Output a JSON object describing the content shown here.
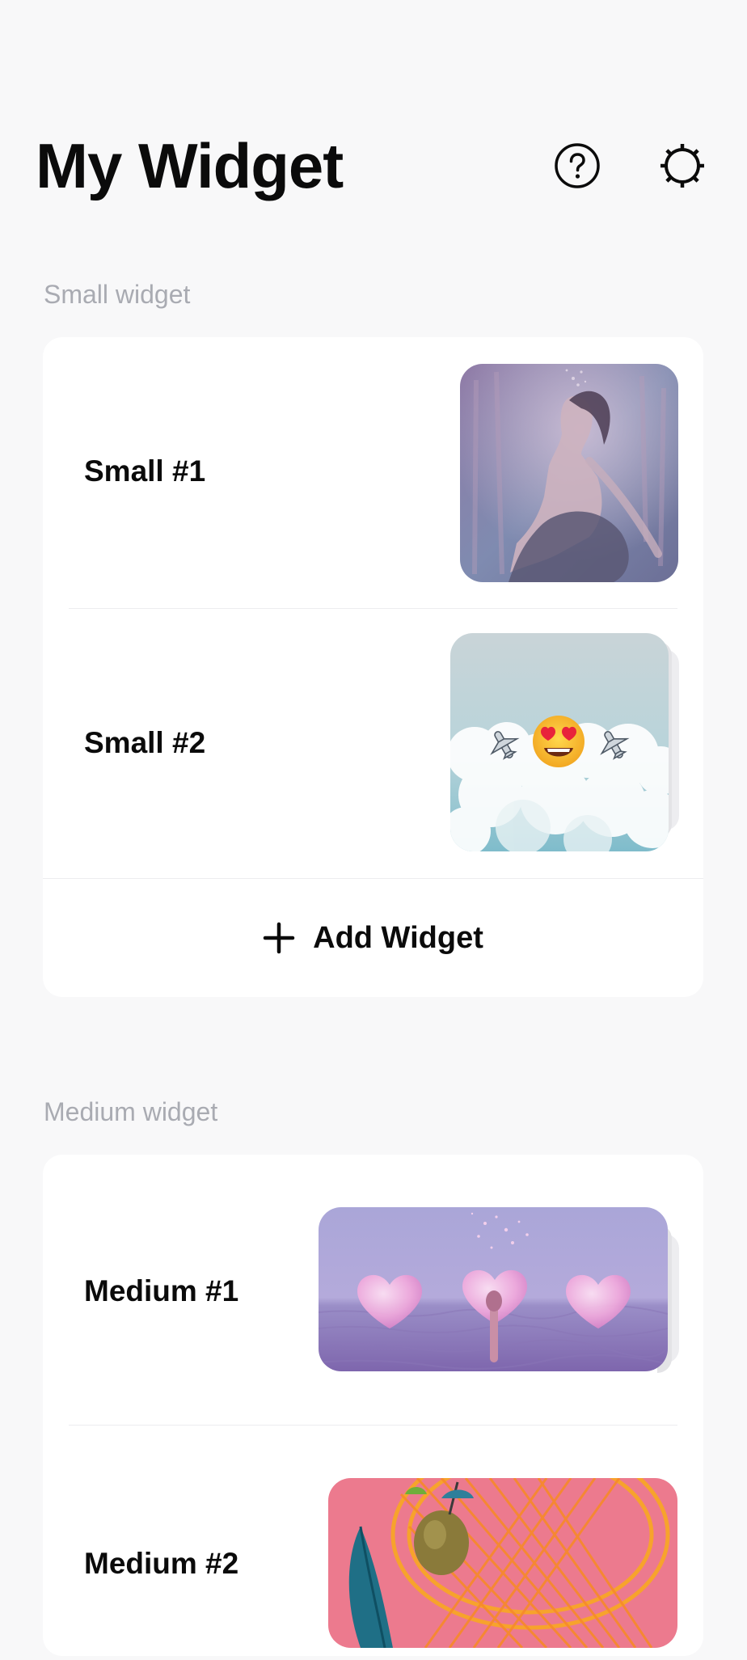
{
  "header": {
    "title": "My Widget",
    "help_icon": "help-circle-icon",
    "settings_icon": "gear-icon"
  },
  "small_section": {
    "label": "Small widget",
    "items": [
      {
        "label": "Small #1",
        "preview": "woman-underwater-photo"
      },
      {
        "label": "Small #2",
        "preview": "clouds-airplane-heart-eyes-emoji-photo"
      }
    ],
    "add_button": {
      "icon": "plus-icon",
      "label": "Add Widget"
    }
  },
  "medium_section": {
    "label": "Medium widget",
    "items": [
      {
        "label": "Medium #1",
        "preview": "pink-hearts-over-water-photo"
      },
      {
        "label": "Medium #2",
        "preview": "orange-chair-coconut-pink-photo"
      }
    ]
  },
  "colors": {
    "background": "#f8f8f9",
    "card": "#ffffff",
    "section_label": "#a9abb2",
    "text": "#0b0b0b"
  }
}
